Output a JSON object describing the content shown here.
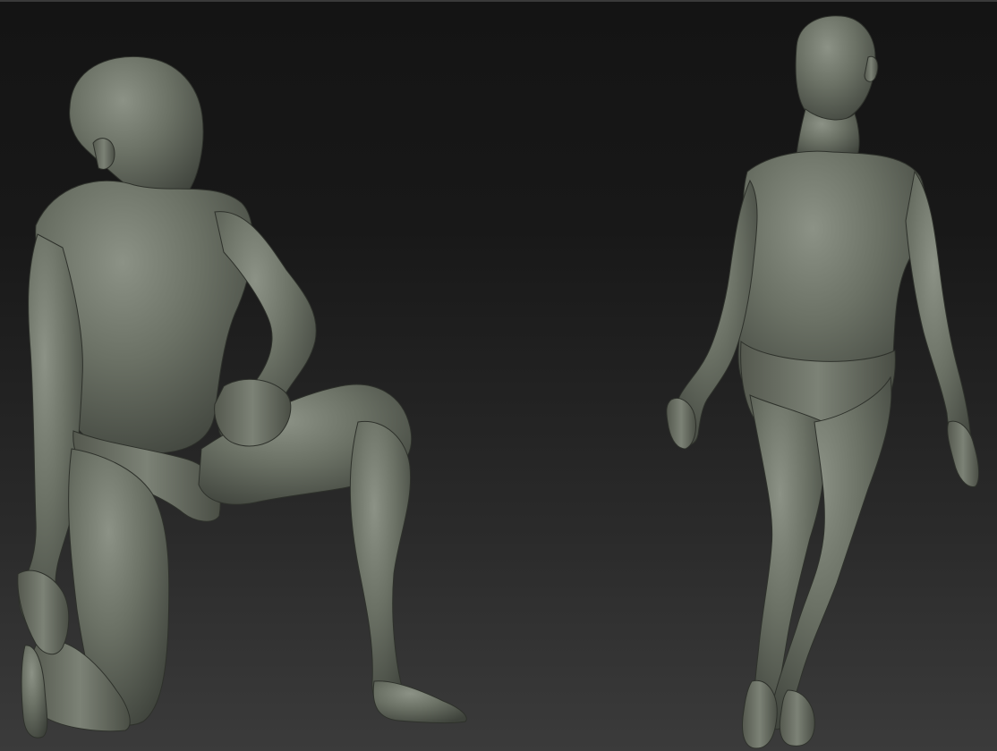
{
  "viewport": {
    "background_top": "#141414",
    "background_bottom": "#3b3b3b",
    "clay_color": "#6b7165"
  },
  "models": [
    {
      "name": "kneeling-old-man-sculpt",
      "pose": "kneeling"
    },
    {
      "name": "standing-old-man-sculpt",
      "pose": "standing"
    }
  ]
}
